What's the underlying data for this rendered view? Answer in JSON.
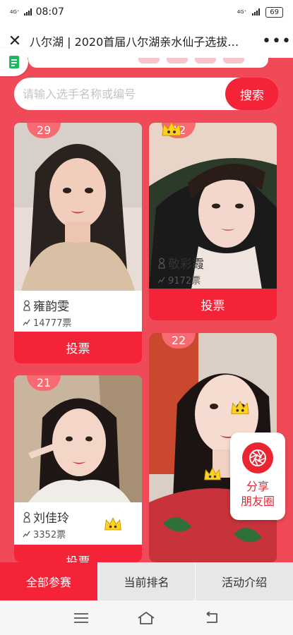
{
  "status": {
    "time": "08:07",
    "network_left": "4G⁺",
    "network_right": "4G⁺",
    "battery": "69"
  },
  "header": {
    "title": "八尔湖 | 2020首届八尔湖亲水仙子选拔…"
  },
  "search": {
    "placeholder": "请输入选手名称或编号",
    "button_label": "搜索"
  },
  "contestants": [
    {
      "number": "29",
      "name": "雍韵雯",
      "votes": "14777票",
      "vote_label": "投票"
    },
    {
      "number": "12",
      "name": "敬彩霞",
      "votes": "9172票",
      "vote_label": "投票"
    },
    {
      "number": "21",
      "name": "刘佳玲",
      "votes": "3352票",
      "vote_label": "投票"
    },
    {
      "number": "22"
    }
  ],
  "share": {
    "line1": "分享",
    "line2": "朋友圈"
  },
  "nav": {
    "tabs": [
      "全部参赛",
      "当前排名",
      "活动介绍"
    ],
    "active_index": 0
  },
  "icons": {
    "close": "close-icon",
    "more": "more-dots-icon",
    "doc": "document-icon",
    "crown": "crown-sticker",
    "person": "person-icon",
    "vote": "vote-icon",
    "camera": "camera-shutter-icon"
  },
  "colors": {
    "accent": "#f42338",
    "badge": "#f76a72",
    "page_bg": "#f04a58"
  }
}
